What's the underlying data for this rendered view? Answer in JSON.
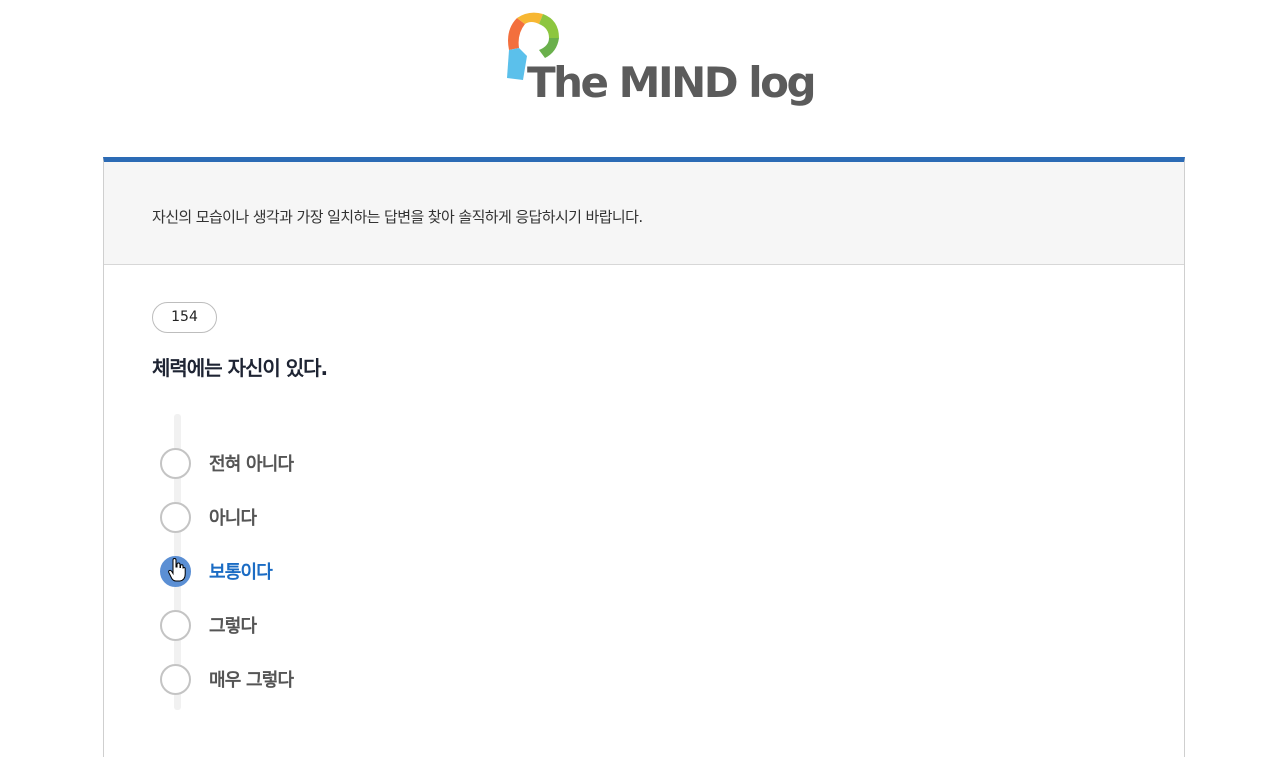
{
  "brand": {
    "name": "The MIND log"
  },
  "instruction": "자신의 모습이나 생각과 가장 일치하는 답변을 찾아 솔직하게 응답하시기 바랍니다.",
  "question": {
    "number": "154",
    "text": "체력에는 자신이 있다."
  },
  "options": [
    {
      "label": "전혀 아니다",
      "checked": false
    },
    {
      "label": "아니다",
      "checked": false
    },
    {
      "label": "보통이다",
      "checked": true
    },
    {
      "label": "그렇다",
      "checked": false
    },
    {
      "label": "매우 그렇다",
      "checked": false
    }
  ],
  "colors": {
    "accent_bar": "#2c6bb5",
    "selected_radio": "#5b8fd4",
    "selected_text": "#1b6cc4"
  }
}
